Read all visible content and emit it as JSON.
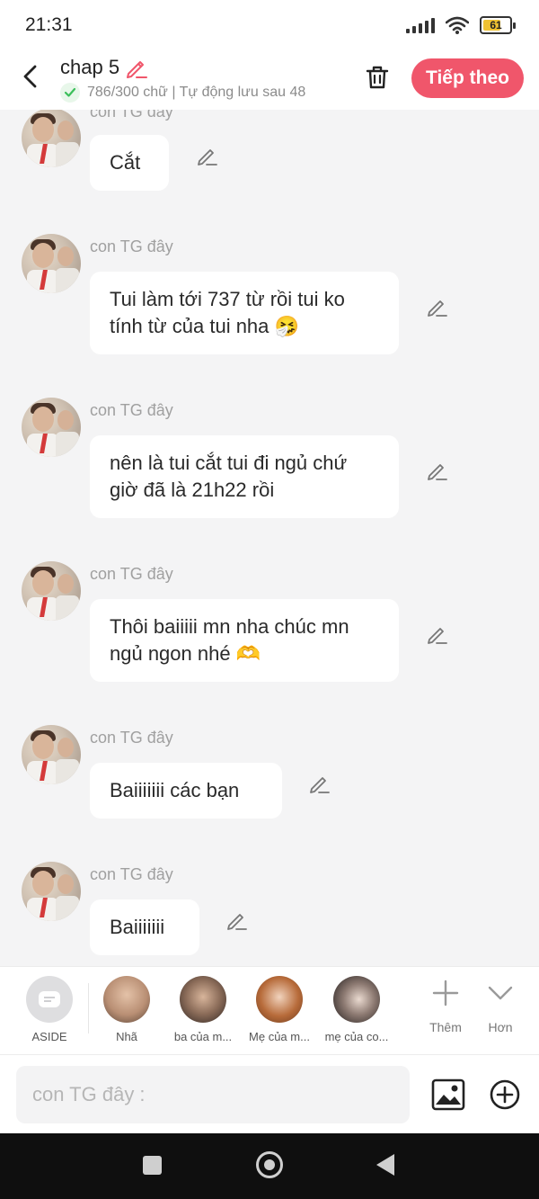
{
  "status": {
    "time": "21:31",
    "battery": "61"
  },
  "header": {
    "title": "chap 5",
    "subtitle": "786/300 chữ | Tự động lưu sau 48",
    "next_label": "Tiếp theo"
  },
  "messages": [
    {
      "sender": "con TG đây",
      "text": "Cắt"
    },
    {
      "sender": "con TG đây",
      "text": "Tui làm tới 737 từ rồi tui ko tính từ của tui nha 🤧"
    },
    {
      "sender": "con TG đây",
      "text": "nên là tui cắt tui đi ngủ chứ giờ đã là 21h22 rồi"
    },
    {
      "sender": "con TG đây",
      "text": "Thôi baiiiii mn nha chúc mn ngủ ngon nhé 🫶"
    },
    {
      "sender": "con TG đây",
      "text": "Baiiiiiii các bạn"
    },
    {
      "sender": "con TG đây",
      "text": "Baiiiiiii"
    }
  ],
  "characters": [
    {
      "label": "ASIDE"
    },
    {
      "label": "Nhã"
    },
    {
      "label": "ba của m..."
    },
    {
      "label": "Mẹ của m..."
    },
    {
      "label": "mẹ của co..."
    }
  ],
  "actions": {
    "more_label": "Thêm",
    "expand_label": "Hơn"
  },
  "composer": {
    "placeholder": "con TG đây :"
  }
}
